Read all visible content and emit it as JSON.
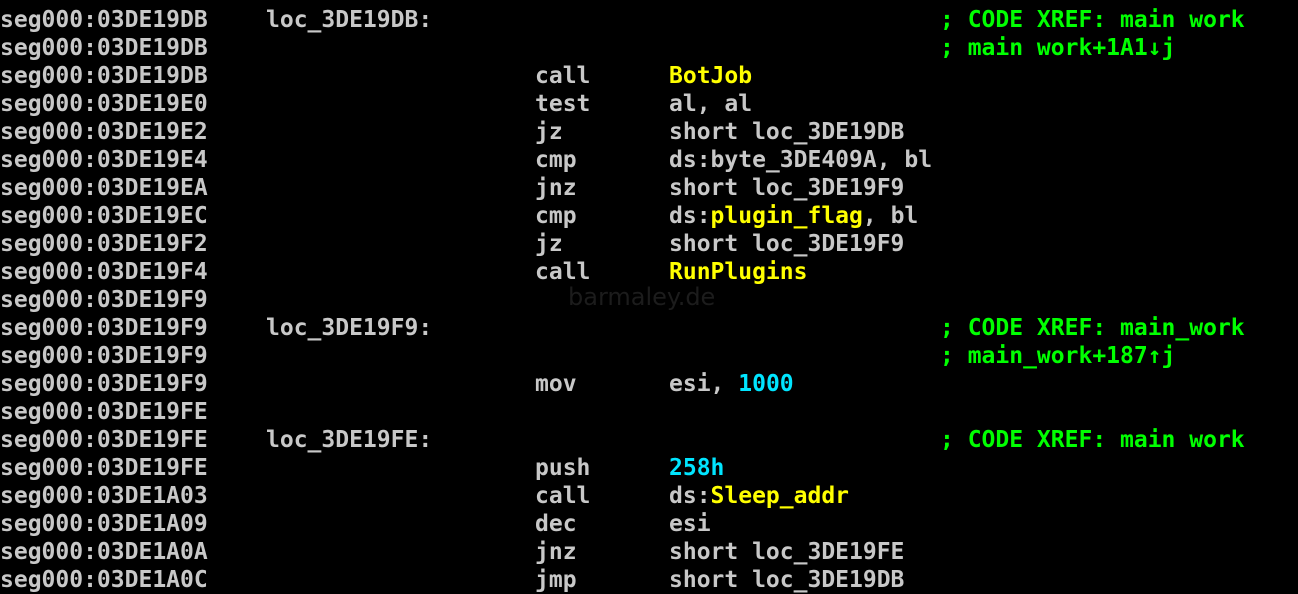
{
  "colors": {
    "background": "#000000",
    "text": "#c8c8c8",
    "name": "#ffff00",
    "number": "#00e5ff",
    "comment": "#00ff00"
  },
  "watermark": "barmaley.de",
  "lines": [
    {
      "addr": "seg000:03DE19DB",
      "label": "loc_3DE19DB:",
      "mnem": "",
      "ops": [],
      "comment": "; CODE XREF: main work"
    },
    {
      "addr": "seg000:03DE19DB",
      "label": "",
      "mnem": "",
      "ops": [],
      "comment": "; main work+1A1↓j"
    },
    {
      "addr": "seg000:03DE19DB",
      "label": "",
      "mnem": "call",
      "ops": [
        {
          "t": "BotJob",
          "c": "name"
        }
      ],
      "comment": ""
    },
    {
      "addr": "seg000:03DE19E0",
      "label": "",
      "mnem": "test",
      "ops": [
        {
          "t": "al, al",
          "c": "plain"
        }
      ],
      "comment": ""
    },
    {
      "addr": "seg000:03DE19E2",
      "label": "",
      "mnem": "jz",
      "ops": [
        {
          "t": "short loc_3DE19DB",
          "c": "plain"
        }
      ],
      "comment": ""
    },
    {
      "addr": "seg000:03DE19E4",
      "label": "",
      "mnem": "cmp",
      "ops": [
        {
          "t": "ds:byte_3DE409A, bl",
          "c": "plain"
        }
      ],
      "comment": ""
    },
    {
      "addr": "seg000:03DE19EA",
      "label": "",
      "mnem": "jnz",
      "ops": [
        {
          "t": "short loc_3DE19F9",
          "c": "plain"
        }
      ],
      "comment": ""
    },
    {
      "addr": "seg000:03DE19EC",
      "label": "",
      "mnem": "cmp",
      "ops": [
        {
          "t": "ds:",
          "c": "plain"
        },
        {
          "t": "plugin_flag",
          "c": "name"
        },
        {
          "t": ", bl",
          "c": "plain"
        }
      ],
      "comment": ""
    },
    {
      "addr": "seg000:03DE19F2",
      "label": "",
      "mnem": "jz",
      "ops": [
        {
          "t": "short loc_3DE19F9",
          "c": "plain"
        }
      ],
      "comment": ""
    },
    {
      "addr": "seg000:03DE19F4",
      "label": "",
      "mnem": "call",
      "ops": [
        {
          "t": "RunPlugins",
          "c": "name"
        }
      ],
      "comment": ""
    },
    {
      "addr": "seg000:03DE19F9",
      "label": "",
      "mnem": "",
      "ops": [],
      "comment": ""
    },
    {
      "addr": "seg000:03DE19F9",
      "label": "loc_3DE19F9:",
      "mnem": "",
      "ops": [],
      "comment": "; CODE XREF: main_work"
    },
    {
      "addr": "seg000:03DE19F9",
      "label": "",
      "mnem": "",
      "ops": [],
      "comment": "; main_work+187↑j"
    },
    {
      "addr": "seg000:03DE19F9",
      "label": "",
      "mnem": "mov",
      "ops": [
        {
          "t": "esi, ",
          "c": "plain"
        },
        {
          "t": "1000",
          "c": "num"
        }
      ],
      "comment": ""
    },
    {
      "addr": "seg000:03DE19FE",
      "label": "",
      "mnem": "",
      "ops": [],
      "comment": ""
    },
    {
      "addr": "seg000:03DE19FE",
      "label": "loc_3DE19FE:",
      "mnem": "",
      "ops": [],
      "comment": "; CODE XREF: main work"
    },
    {
      "addr": "seg000:03DE19FE",
      "label": "",
      "mnem": "push",
      "ops": [
        {
          "t": "258h",
          "c": "num"
        }
      ],
      "comment": ""
    },
    {
      "addr": "seg000:03DE1A03",
      "label": "",
      "mnem": "call",
      "ops": [
        {
          "t": "ds:",
          "c": "plain"
        },
        {
          "t": "Sleep_addr",
          "c": "name"
        }
      ],
      "comment": ""
    },
    {
      "addr": "seg000:03DE1A09",
      "label": "",
      "mnem": "dec",
      "ops": [
        {
          "t": "esi",
          "c": "plain"
        }
      ],
      "comment": ""
    },
    {
      "addr": "seg000:03DE1A0A",
      "label": "",
      "mnem": "jnz",
      "ops": [
        {
          "t": "short loc_3DE19FE",
          "c": "plain"
        }
      ],
      "comment": ""
    },
    {
      "addr": "seg000:03DE1A0C",
      "label": "",
      "mnem": "jmp",
      "ops": [
        {
          "t": "short loc_3DE19DB",
          "c": "plain"
        }
      ],
      "comment": ""
    }
  ]
}
